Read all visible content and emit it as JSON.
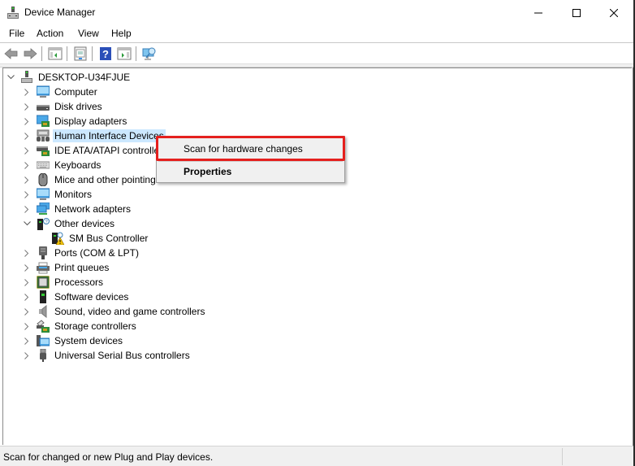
{
  "window": {
    "title": "Device Manager",
    "controls": [
      "minimize",
      "maximize",
      "close"
    ]
  },
  "menu": {
    "items": [
      {
        "label": "File"
      },
      {
        "label": "Action"
      },
      {
        "label": "View"
      },
      {
        "label": "Help"
      }
    ]
  },
  "toolbar": {
    "buttons": [
      {
        "name": "back",
        "icon": "back-arrow-icon",
        "enabled": false
      },
      {
        "name": "forward",
        "icon": "forward-arrow-icon",
        "enabled": false
      },
      {
        "name": "show-hide-console-tree",
        "icon": "console-tree-icon"
      },
      {
        "name": "properties",
        "icon": "properties-icon"
      },
      {
        "name": "help",
        "icon": "help-icon",
        "glyph": "?"
      },
      {
        "name": "show-action-pane",
        "icon": "action-pane-icon"
      },
      {
        "name": "scan-for-hardware-changes",
        "icon": "monitor-scan-icon"
      }
    ]
  },
  "tree": {
    "root": {
      "label": "DESKTOP-U34FJUE",
      "expanded": true,
      "icon": "computer-tower-icon"
    },
    "items": [
      {
        "label": "Computer",
        "icon": "monitor-icon",
        "expanded": false
      },
      {
        "label": "Disk drives",
        "icon": "disk-drive-icon",
        "expanded": false
      },
      {
        "label": "Display adapters",
        "icon": "display-adapter-icon",
        "expanded": false
      },
      {
        "label": "Human Interface Devices",
        "icon": "hid-icon",
        "expanded": false,
        "selected": true
      },
      {
        "label": "IDE ATA/ATAPI controllers",
        "icon": "ide-controller-icon",
        "expanded": false
      },
      {
        "label": "Keyboards",
        "icon": "keyboard-icon",
        "expanded": false
      },
      {
        "label": "Mice and other pointing devices",
        "icon": "mouse-icon",
        "expanded": false
      },
      {
        "label": "Monitors",
        "icon": "monitor-icon",
        "expanded": false
      },
      {
        "label": "Network adapters",
        "icon": "network-adapter-icon",
        "expanded": false
      },
      {
        "label": "Other devices",
        "icon": "unknown-device-icon",
        "expanded": true,
        "children": [
          {
            "label": "SM Bus Controller",
            "icon": "warning-device-icon"
          }
        ]
      },
      {
        "label": "Ports (COM & LPT)",
        "icon": "port-icon",
        "expanded": false
      },
      {
        "label": "Print queues",
        "icon": "printer-icon",
        "expanded": false
      },
      {
        "label": "Processors",
        "icon": "processor-icon",
        "expanded": false
      },
      {
        "label": "Software devices",
        "icon": "software-device-icon",
        "expanded": false
      },
      {
        "label": "Sound, video and game controllers",
        "icon": "speaker-icon",
        "expanded": false
      },
      {
        "label": "Storage controllers",
        "icon": "storage-controller-icon",
        "expanded": false
      },
      {
        "label": "System devices",
        "icon": "system-device-icon",
        "expanded": false
      },
      {
        "label": "Universal Serial Bus controllers",
        "icon": "usb-icon",
        "expanded": false
      }
    ]
  },
  "context_menu": {
    "items": [
      {
        "label": "Scan for hardware changes",
        "highlighted": true
      },
      {
        "label": "Properties",
        "bold": true
      }
    ]
  },
  "statusbar": {
    "text": "Scan for changed or new Plug and Play devices."
  },
  "colors": {
    "selection": "#cce8ff",
    "highlight_border": "#e5201e",
    "menu_bg": "#f0f0f0"
  }
}
